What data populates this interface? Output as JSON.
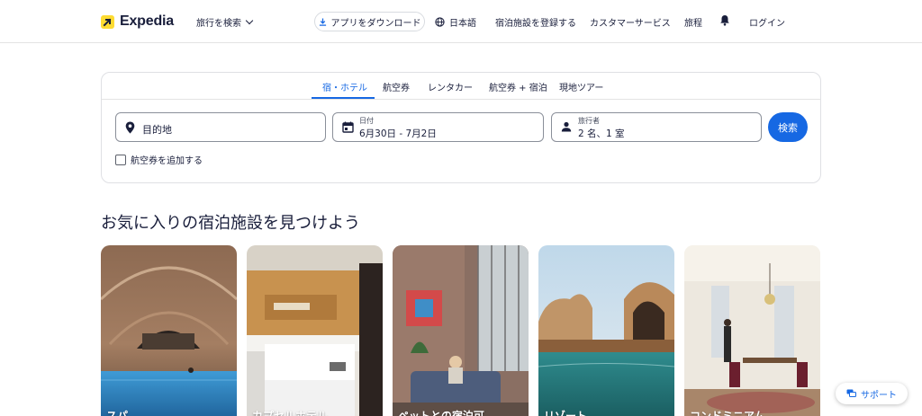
{
  "header": {
    "brand": "Expedia",
    "trip_search": "旅行を検索",
    "app_download": "アプリをダウンロード",
    "language": "日本語",
    "list_property": "宿泊施設を登録する",
    "customer_service": "カスタマーサービス",
    "trips": "旅程",
    "login": "ログイン"
  },
  "search": {
    "tabs": [
      {
        "label": "宿・ホテル",
        "active": true
      },
      {
        "label": "航空券",
        "active": false
      },
      {
        "label": "レンタカー",
        "active": false
      },
      {
        "label": "航空券 + 宿泊",
        "active": false
      },
      {
        "label": "現地ツアー",
        "active": false
      }
    ],
    "destination_placeholder": "目的地",
    "date_label": "日付",
    "date_value": "6月30日 - 7月2日",
    "travelers_label": "旅行者",
    "travelers_value": "2 名、1 室",
    "search_button": "検索",
    "add_flight": "航空券を追加する"
  },
  "favorites": {
    "title": "お気に入りの宿泊施設を見つけよう",
    "tiles": [
      {
        "label": "スパ"
      },
      {
        "label": "カプセルホテル"
      },
      {
        "label": "ペットとの宿泊可"
      },
      {
        "label": "リゾート"
      },
      {
        "label": "コンドミニアム"
      }
    ]
  },
  "support": {
    "label": "サポート"
  },
  "colors": {
    "accent": "#1668e3",
    "brand_yellow": "#fddb32",
    "text": "#191e3b"
  }
}
